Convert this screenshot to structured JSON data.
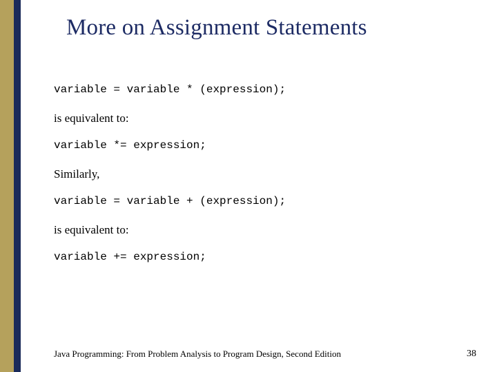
{
  "slide": {
    "title": "More on Assignment Statements",
    "lines": [
      {
        "kind": "code",
        "text": "variable = variable * (expression);"
      },
      {
        "kind": "body",
        "text": "is equivalent to:"
      },
      {
        "kind": "code",
        "text": "variable *= expression;"
      },
      {
        "kind": "body",
        "text": "Similarly,"
      },
      {
        "kind": "code",
        "text": "variable = variable + (expression);"
      },
      {
        "kind": "body",
        "text": "is equivalent to:"
      },
      {
        "kind": "code",
        "text": "variable += expression;"
      }
    ],
    "footer": "Java Programming: From Problem Analysis to Program Design, Second Edition",
    "page_number": "38"
  }
}
